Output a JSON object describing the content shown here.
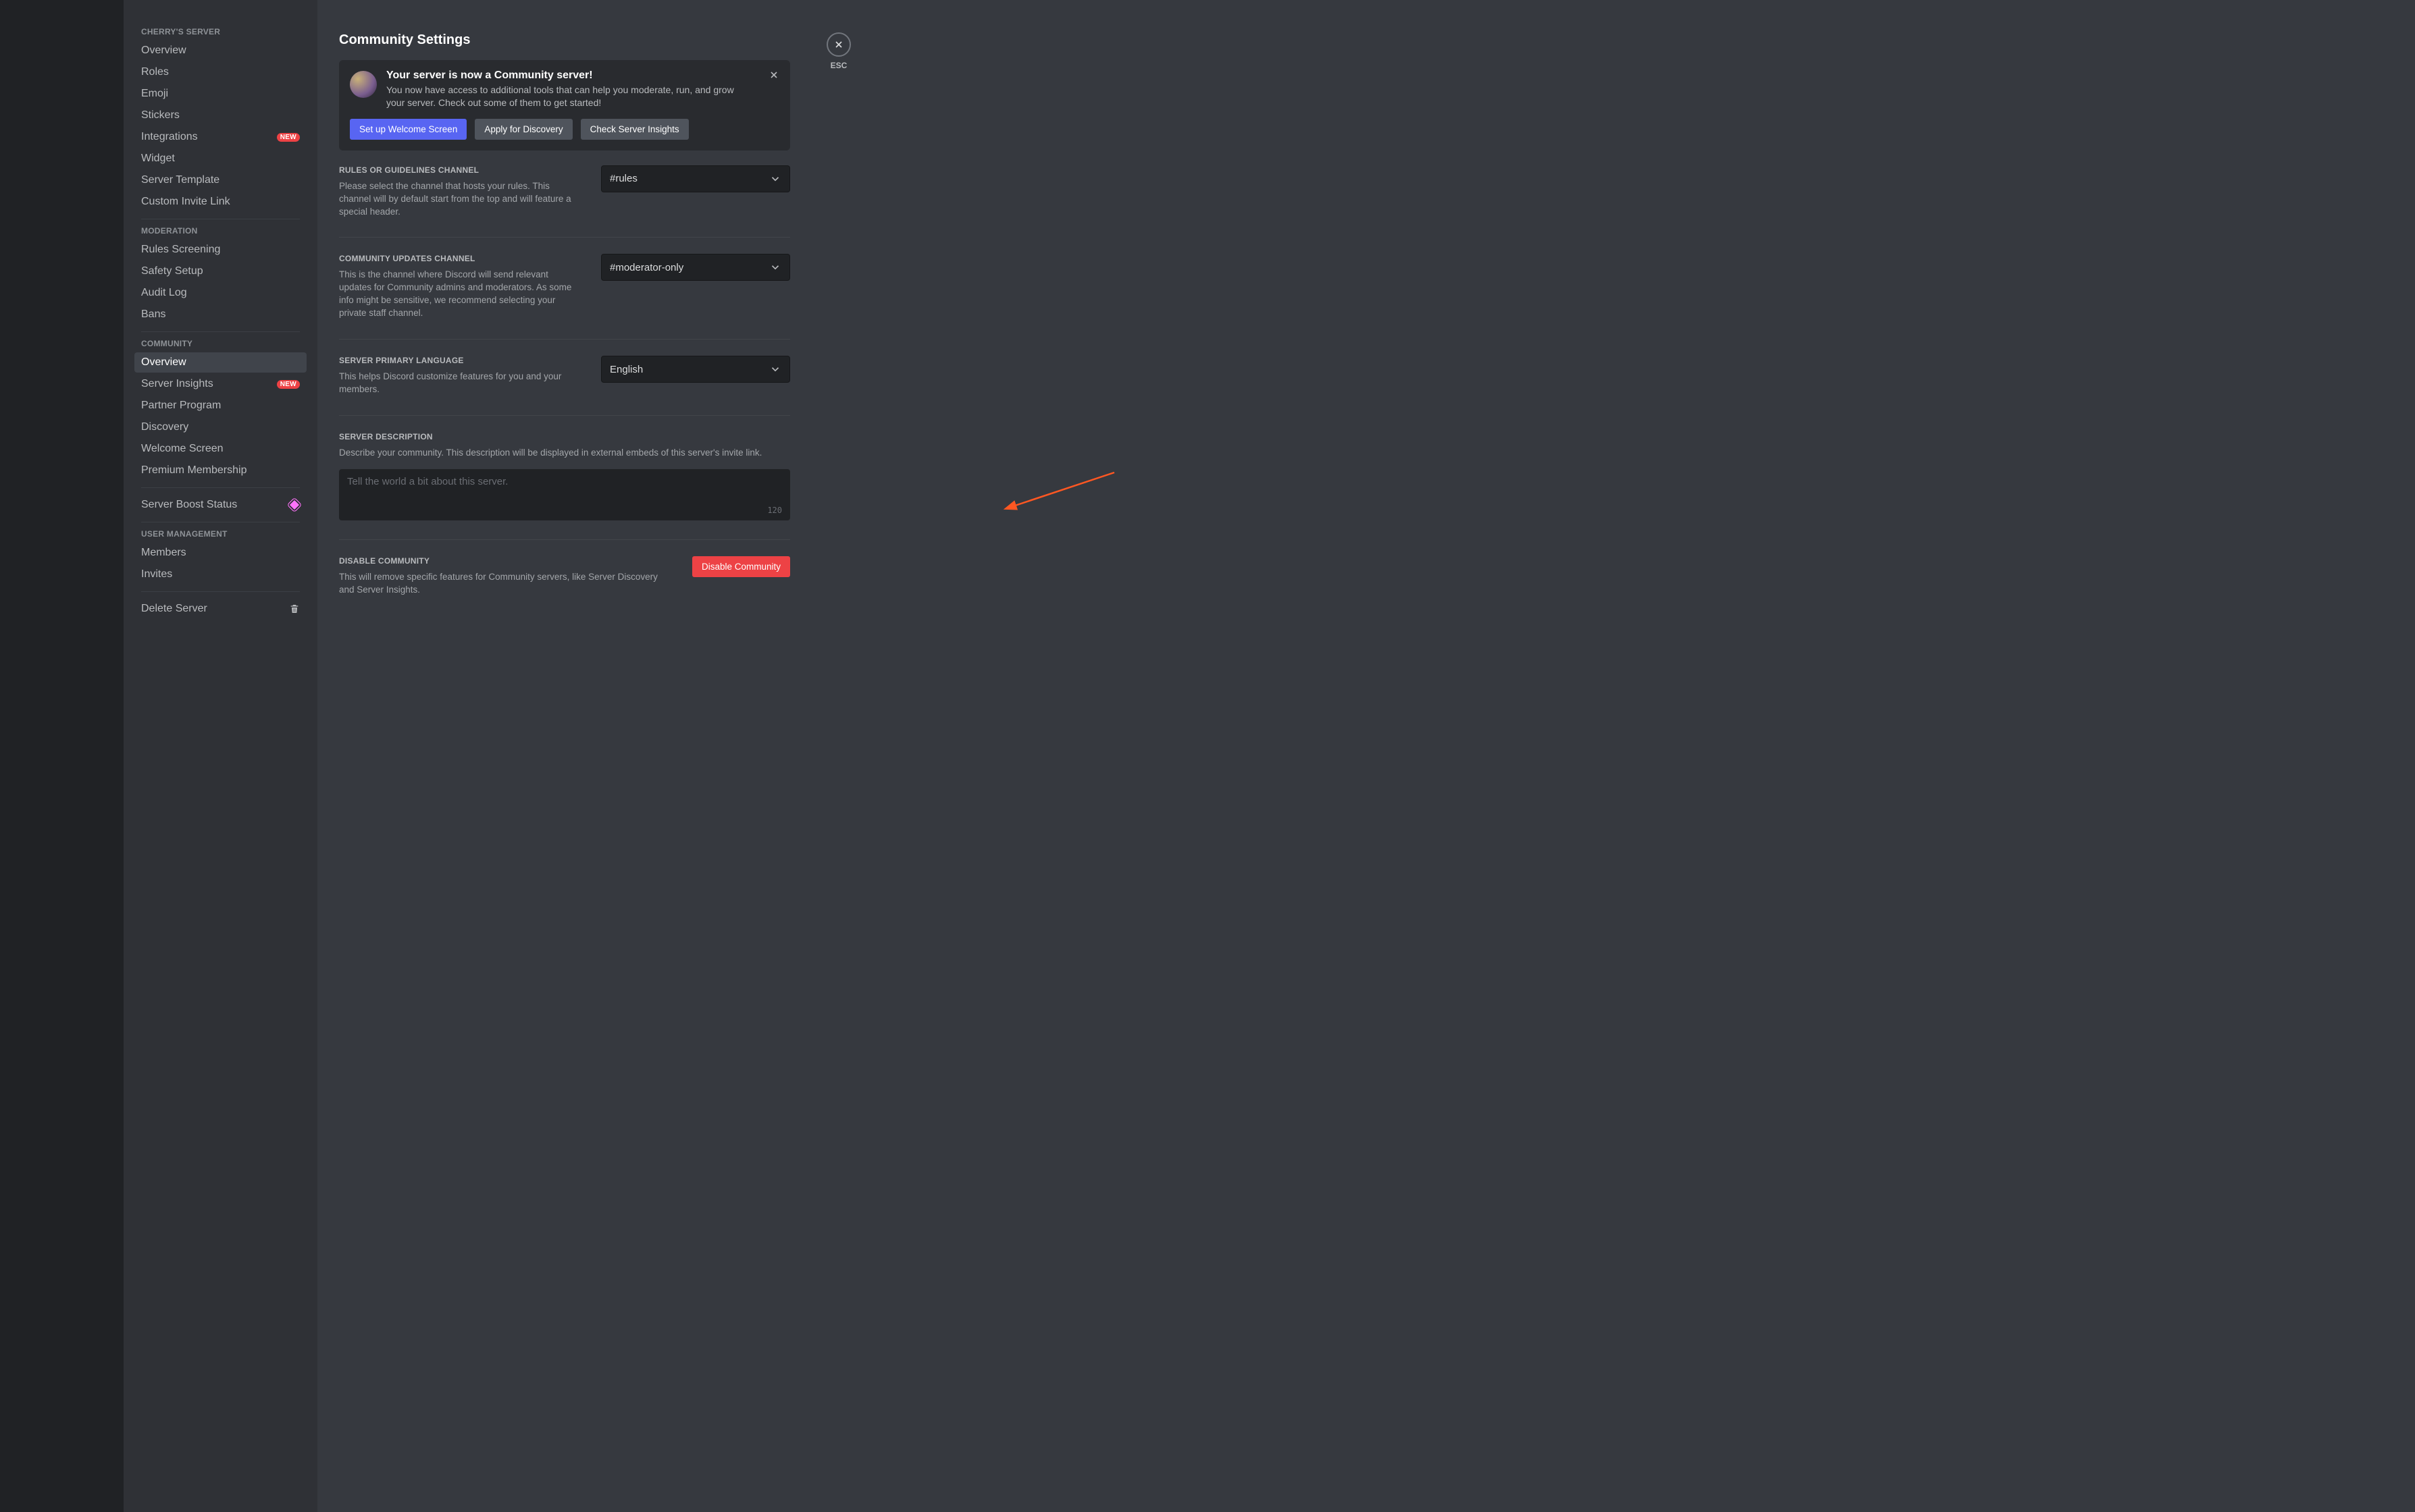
{
  "sidebar": {
    "server_section_label": "CHERRY'S SERVER",
    "server_items": [
      {
        "id": "overview",
        "label": "Overview"
      },
      {
        "id": "roles",
        "label": "Roles"
      },
      {
        "id": "emoji",
        "label": "Emoji"
      },
      {
        "id": "stickers",
        "label": "Stickers"
      },
      {
        "id": "integrations",
        "label": "Integrations",
        "badge": "NEW"
      },
      {
        "id": "widget",
        "label": "Widget"
      },
      {
        "id": "server-template",
        "label": "Server Template"
      },
      {
        "id": "custom-invite-link",
        "label": "Custom Invite Link"
      }
    ],
    "moderation_section_label": "MODERATION",
    "moderation_items": [
      {
        "id": "rules-screening",
        "label": "Rules Screening"
      },
      {
        "id": "safety-setup",
        "label": "Safety Setup"
      },
      {
        "id": "audit-log",
        "label": "Audit Log"
      },
      {
        "id": "bans",
        "label": "Bans"
      }
    ],
    "community_section_label": "COMMUNITY",
    "community_items": [
      {
        "id": "community-overview",
        "label": "Overview",
        "selected": true
      },
      {
        "id": "server-insights",
        "label": "Server Insights",
        "badge": "NEW"
      },
      {
        "id": "partner-program",
        "label": "Partner Program"
      },
      {
        "id": "discovery",
        "label": "Discovery"
      },
      {
        "id": "welcome-screen",
        "label": "Welcome Screen"
      },
      {
        "id": "premium-membership",
        "label": "Premium Membership"
      }
    ],
    "boost_label": "Server Boost Status",
    "user_mgmt_section_label": "USER MANAGEMENT",
    "user_mgmt_items": [
      {
        "id": "members",
        "label": "Members"
      },
      {
        "id": "invites",
        "label": "Invites"
      }
    ],
    "delete_server_label": "Delete Server"
  },
  "page": {
    "title": "Community Settings",
    "esc_label": "ESC"
  },
  "banner": {
    "title": "Your server is now a Community server!",
    "body": "You now have access to additional tools that can help you moderate, run, and grow your server. Check out some of them to get started!",
    "buttons": {
      "welcome": "Set up Welcome Screen",
      "discovery": "Apply for Discovery",
      "insights": "Check Server Insights"
    }
  },
  "rules_section": {
    "label": "RULES OR GUIDELINES CHANNEL",
    "desc": "Please select the channel that hosts your rules. This channel will by default start from the top and will feature a special header.",
    "value": "#rules"
  },
  "updates_section": {
    "label": "COMMUNITY UPDATES CHANNEL",
    "desc": "This is the channel where Discord will send relevant updates for Community admins and moderators. As some info might be sensitive, we recommend selecting your private staff channel.",
    "value": "#moderator-only"
  },
  "language_section": {
    "label": "SERVER PRIMARY LANGUAGE",
    "desc": "This helps Discord customize features for you and your members.",
    "value": "English"
  },
  "description_section": {
    "label": "SERVER DESCRIPTION",
    "desc": "Describe your community. This description will be displayed in external embeds of this server's invite link.",
    "placeholder": "Tell the world a bit about this server.",
    "value": "",
    "counter": "120"
  },
  "disable_section": {
    "label": "DISABLE COMMUNITY",
    "desc": "This will remove specific features for Community servers, like Server Discovery and Server Insights.",
    "button": "Disable Community"
  }
}
